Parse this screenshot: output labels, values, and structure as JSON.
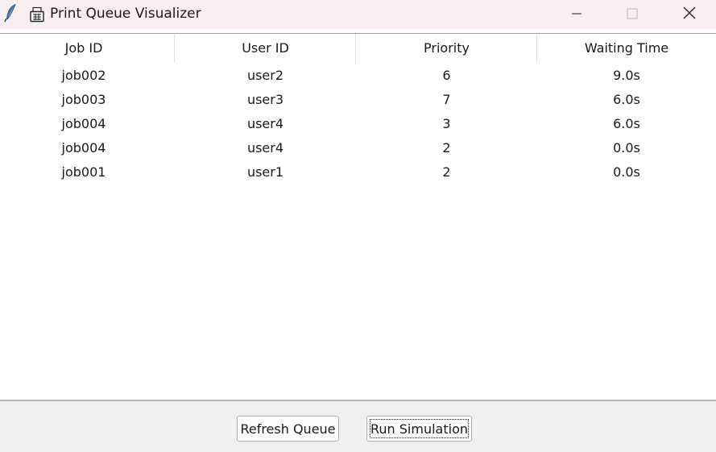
{
  "window": {
    "title": "Print Queue Visualizer",
    "icons": {
      "app": "feather-icon",
      "title_prefix": "printer-icon"
    },
    "controls": [
      "minimize-icon",
      "maximize-icon",
      "close-icon"
    ]
  },
  "table": {
    "columns": [
      "Job ID",
      "User ID",
      "Priority",
      "Waiting Time"
    ],
    "rows": [
      [
        "job002",
        "user2",
        "6",
        "9.0s"
      ],
      [
        "job003",
        "user3",
        "7",
        "6.0s"
      ],
      [
        "job004",
        "user4",
        "3",
        "6.0s"
      ],
      [
        "job004",
        "user4",
        "2",
        "0.0s"
      ],
      [
        "job001",
        "user1",
        "2",
        "0.0s"
      ]
    ]
  },
  "buttons": {
    "refresh_label": "Refresh Queue",
    "run_label": "Run Simulation"
  }
}
